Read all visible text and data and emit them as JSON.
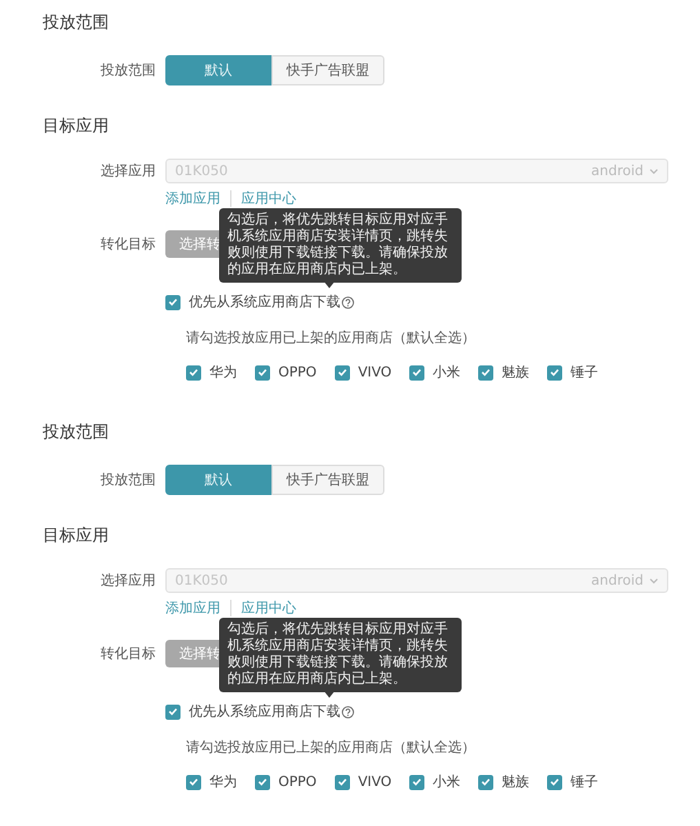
{
  "sections": [
    {
      "scope_title": "投放范围",
      "scope": {
        "label": "投放范围",
        "options": [
          {
            "label": "默认",
            "selected": true
          },
          {
            "label": "快手广告联盟",
            "selected": false
          }
        ]
      },
      "app_title": "目标应用",
      "app": {
        "label": "选择应用",
        "value": "01K050",
        "platform": "android",
        "disabled": true
      },
      "links": [
        "添加应用",
        "应用中心"
      ],
      "target": {
        "label": "转化目标",
        "button": "选择转",
        "disabled": true
      },
      "tooltip": "勾选后，将优先跳转目标应用对应手机系统应用商店安装详情页，跳转失败则使用下载链接下载。请确保投放的应用在应用商店内已上架。",
      "prefer": {
        "label": "优先从系统应用商店下载",
        "checked": true
      },
      "hint": "请勾选投放应用已上架的应用商店（默认全选）",
      "stores": [
        {
          "label": "华为",
          "checked": true
        },
        {
          "label": "OPPO",
          "checked": true
        },
        {
          "label": "VIVO",
          "checked": true
        },
        {
          "label": "小米",
          "checked": true
        },
        {
          "label": "魅族",
          "checked": true
        },
        {
          "label": "锤子",
          "checked": true
        }
      ]
    },
    {
      "scope_title": "投放范围",
      "scope": {
        "label": "投放范围",
        "options": [
          {
            "label": "默认",
            "selected": true
          },
          {
            "label": "快手广告联盟",
            "selected": false
          }
        ]
      },
      "app_title": "目标应用",
      "app": {
        "label": "选择应用",
        "value": "01K050",
        "platform": "android",
        "disabled": true
      },
      "links": [
        "添加应用",
        "应用中心"
      ],
      "target": {
        "label": "转化目标",
        "button": "选择转",
        "disabled": true
      },
      "tooltip": "勾选后，将优先跳转目标应用对应手机系统应用商店安装详情页，跳转失败则使用下载链接下载。请确保投放的应用在应用商店内已上架。",
      "prefer": {
        "label": "优先从系统应用商店下载",
        "checked": true
      },
      "hint": "请勾选投放应用已上架的应用商店（默认全选）",
      "stores": [
        {
          "label": "华为",
          "checked": true
        },
        {
          "label": "OPPO",
          "checked": true
        },
        {
          "label": "VIVO",
          "checked": true
        },
        {
          "label": "小米",
          "checked": true
        },
        {
          "label": "魅族",
          "checked": true
        },
        {
          "label": "锤子",
          "checked": true
        }
      ]
    }
  ]
}
